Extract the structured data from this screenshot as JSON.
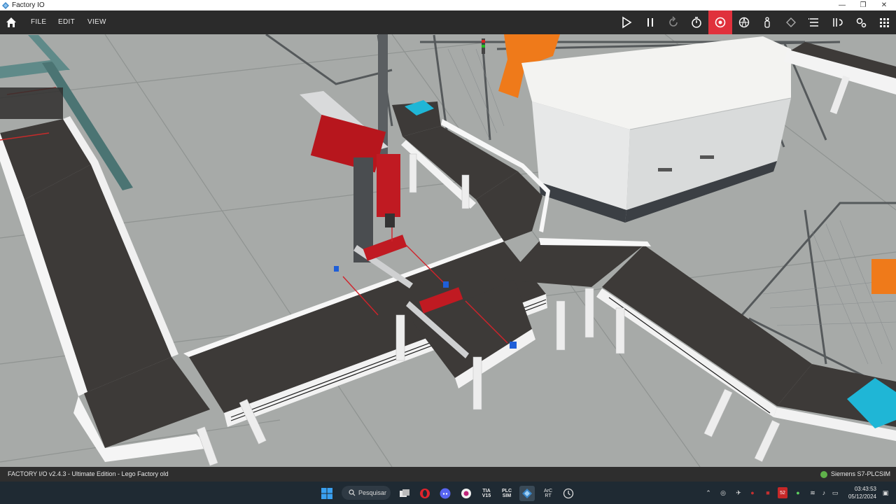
{
  "window": {
    "title": "Factory IO",
    "controls": {
      "minimize": "—",
      "maximize": "❐",
      "close": "✕"
    }
  },
  "menubar": {
    "home_icon": "home-icon",
    "items": [
      {
        "label": "FILE"
      },
      {
        "label": "EDIT"
      },
      {
        "label": "VIEW"
      }
    ]
  },
  "toolbar": {
    "tools": [
      {
        "name": "play-icon"
      },
      {
        "name": "pause-icon"
      },
      {
        "name": "reset-icon"
      },
      {
        "name": "timer-icon"
      },
      {
        "name": "camera-orbit-icon",
        "active": true
      },
      {
        "name": "fly-camera-icon"
      },
      {
        "name": "first-person-icon"
      },
      {
        "name": "select-icon"
      },
      {
        "name": "list-icon"
      },
      {
        "name": "sensor-tags-icon"
      },
      {
        "name": "drivers-icon"
      },
      {
        "name": "grid-icon"
      }
    ],
    "active_color": "#e0313c"
  },
  "status": {
    "left": "FACTORY I/O v2.4.3 - Ultimate Edition - Lego Factory old",
    "driver": "Siemens S7-PLCSIM",
    "driver_status_color": "#5fb24a"
  },
  "taskbar": {
    "search_label": "Pesquisar",
    "apps": [
      {
        "name": "windows-start-icon"
      },
      {
        "name": "task-view-icon"
      },
      {
        "name": "opera-icon"
      },
      {
        "name": "discord-icon"
      },
      {
        "name": "record-app-icon"
      },
      {
        "name": "tia-portal-icon",
        "label": "TIA V15"
      },
      {
        "name": "plcsim-icon",
        "label": "PLC SIM"
      },
      {
        "name": "factory-io-icon"
      },
      {
        "name": "arc-rt-icon",
        "label": "ArC RT"
      },
      {
        "name": "clock-app-icon"
      }
    ],
    "tray_badge": "52",
    "time": "03:43:53",
    "date": "05/12/2024"
  }
}
